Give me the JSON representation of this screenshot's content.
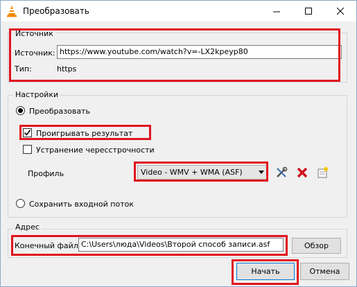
{
  "window": {
    "title": "Преобразовать",
    "minimize_icon": "minimize-icon",
    "maximize_icon": "maximize-icon",
    "close_icon": "close-icon"
  },
  "source": {
    "legend": "Источник",
    "source_label": "Источник:",
    "source_value": "https://www.youtube.com/watch?v=-LX2kpeyp80",
    "type_label": "Тип:",
    "type_value": "https"
  },
  "settings": {
    "legend": "Настройки",
    "convert_label": "Преобразовать",
    "convert_selected": true,
    "play_result_label": "Проигрывать результат",
    "play_result_checked": true,
    "deinterlace_label": "Устранение чересстрочности",
    "deinterlace_checked": false,
    "profile_label": "Профиль",
    "profile_value": "Video - WMV + WMA (ASF)",
    "profile_tools": [
      "wrench-screwdriver-icon",
      "delete-red-x-icon",
      "new-profile-icon"
    ],
    "keep_stream_label": "Сохранить входной поток",
    "keep_stream_selected": false
  },
  "address": {
    "legend": "Адрес",
    "dest_label": "Конечный файл:",
    "dest_value": "C:\\Users\\люда\\Videos\\Второй способ записи.asf",
    "browse_label": "Обзор"
  },
  "footer": {
    "start_label": "Начать",
    "cancel_label": "Отмена"
  },
  "colors": {
    "highlight": "#e0121e",
    "window_bg": "#f0f0f0",
    "titlebar_bg": "#ffffff",
    "button_bg": "#e1e1e1"
  }
}
